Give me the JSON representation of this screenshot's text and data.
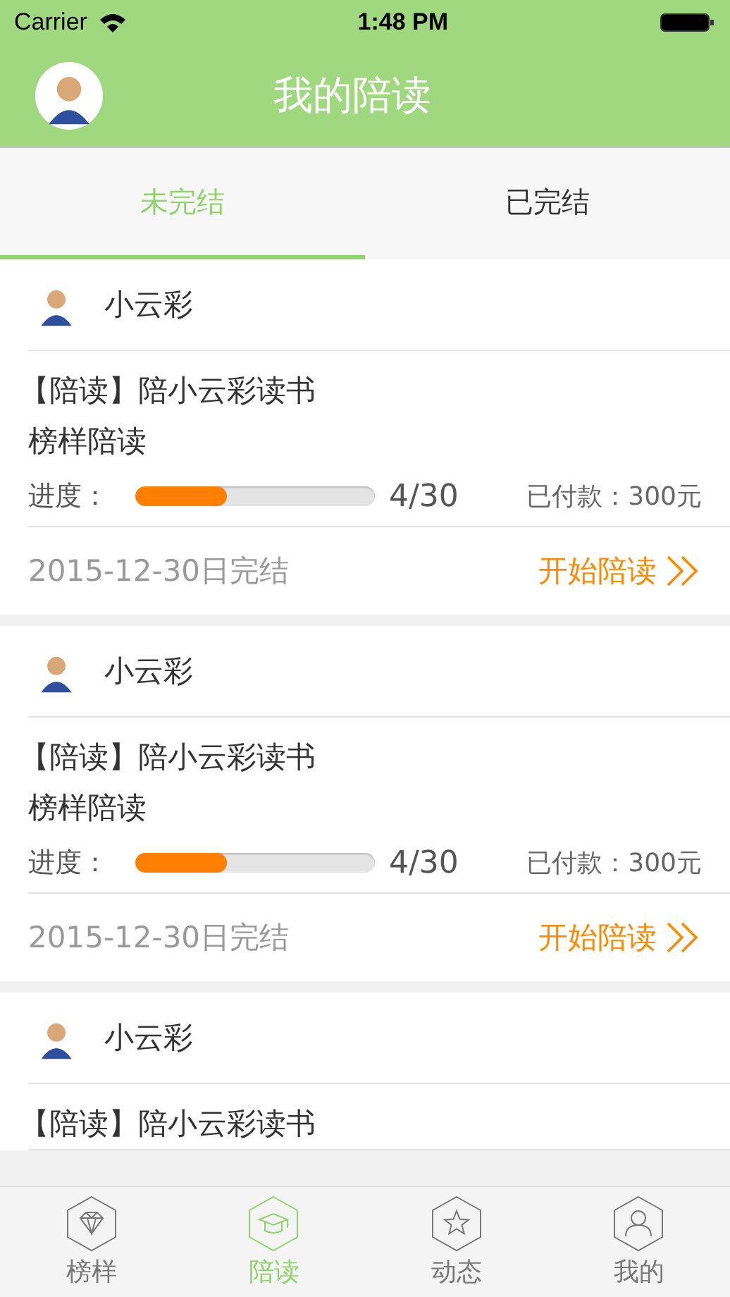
{
  "status_bar": {
    "carrier": "Carrier",
    "time": "1:48 PM"
  },
  "nav": {
    "title": "我的陪读"
  },
  "tabs": [
    {
      "label": "未完结",
      "selected": true
    },
    {
      "label": "已完结",
      "selected": false
    }
  ],
  "cards": [
    {
      "name": "小云彩",
      "title": "【陪读】陪小云彩读书",
      "subtitle": "榜样陪读",
      "progress_label": "进度：",
      "level": 0.38,
      "progress_text": "4/30",
      "paid": "已付款：300元",
      "date": "2015-12-30日完结",
      "action": "开始陪读"
    },
    {
      "name": "小云彩",
      "title": "【陪读】陪小云彩读书",
      "subtitle": "榜样陪读",
      "progress_label": "进度：",
      "level": 0.38,
      "progress_text": "4/30",
      "paid": "已付款：300元",
      "date": "2015-12-30日完结",
      "action": "开始陪读"
    },
    {
      "name": "小云彩",
      "title": "【陪读】陪小云彩读书"
    }
  ],
  "tab_bar": [
    {
      "kind": "diamond",
      "label": "榜样",
      "selected": false
    },
    {
      "kind": "cap",
      "label": "陪读",
      "selected": true
    },
    {
      "kind": "star",
      "label": "动态",
      "selected": false
    },
    {
      "kind": "person",
      "label": "我的",
      "selected": false
    }
  ]
}
